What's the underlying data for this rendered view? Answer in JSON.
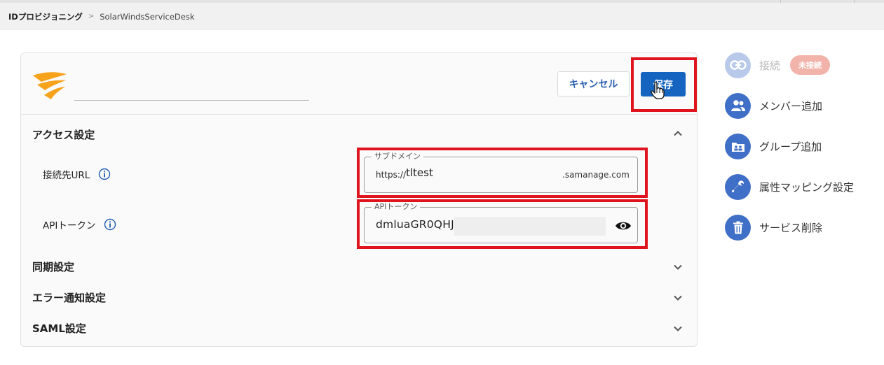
{
  "breadcrumb": {
    "root": "IDプロビジョニング",
    "separator": ">",
    "current": "SolarWindsServiceDesk"
  },
  "header": {
    "name_value": "",
    "cancel_label": "キャンセル",
    "save_label": "保存"
  },
  "sections": {
    "access": {
      "title": "アクセス設定",
      "expanded": true
    },
    "sync": {
      "title": "同期設定",
      "expanded": false
    },
    "error": {
      "title": "エラー通知設定",
      "expanded": false
    },
    "saml": {
      "title": "SAML設定",
      "expanded": false
    }
  },
  "fields": {
    "url": {
      "label": "接続先URL",
      "legend": "サブドメイン",
      "prefix": "https://",
      "value": "tltest",
      "suffix": ".samanage.com"
    },
    "token": {
      "label": "APIトークン",
      "legend": "APIトークン",
      "value": "dmluaGR0QHJ"
    }
  },
  "side_actions": {
    "connect": {
      "label": "接続",
      "badge": "未接続",
      "icon": "link-icon"
    },
    "add_member": {
      "label": "メンバー追加",
      "icon": "users-icon"
    },
    "add_group": {
      "label": "グループ追加",
      "icon": "group-icon"
    },
    "attr_mapping": {
      "label": "属性マッピング設定",
      "icon": "wrench-icon"
    },
    "delete_service": {
      "label": "サービス削除",
      "icon": "trash-icon"
    }
  },
  "colors": {
    "primary": "#1565c0",
    "highlight": "#e0141e",
    "side_icon": "#3f6fc7",
    "badge": "#f2b3aa",
    "logo": "#f7a21b"
  }
}
